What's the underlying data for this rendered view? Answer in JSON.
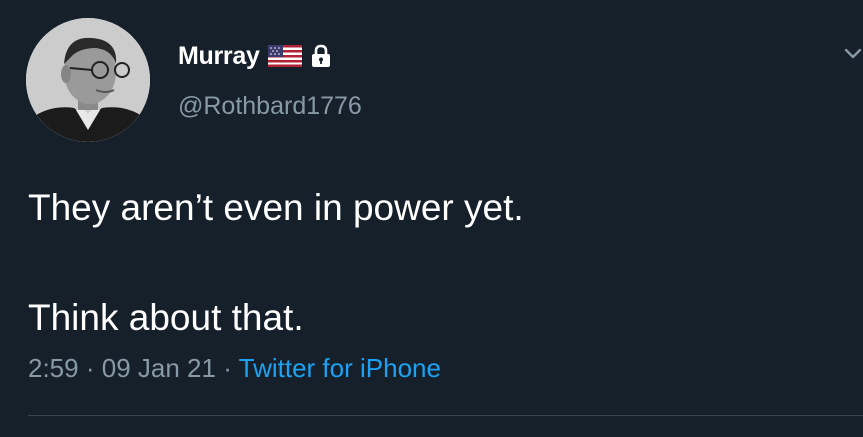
{
  "tweet": {
    "display_name": "Murray",
    "handle": "@Rothbard1776",
    "text_line_1": "They aren’t even in power yet.",
    "text_line_2": "Think about that.",
    "time": "2:59",
    "separator": "·",
    "date": "09 Jan 21",
    "source": "Twitter for iPhone"
  },
  "icons": {
    "badge_1": "us-flag-icon",
    "badge_2": "lock-icon",
    "menu": "chevron-down-icon"
  },
  "colors": {
    "background": "#15202b",
    "primary_text": "#ffffff",
    "secondary_text": "#8899a6",
    "link": "#1da1f2"
  }
}
